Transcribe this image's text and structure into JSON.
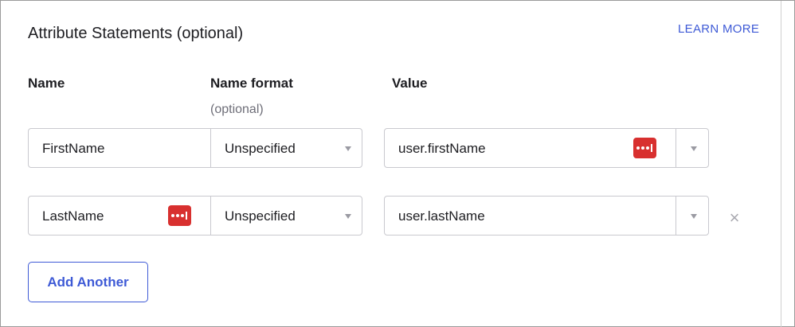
{
  "section": {
    "title": "Attribute Statements (optional)",
    "learn_more": "LEARN MORE"
  },
  "columns": {
    "name": "Name",
    "name_format": "Name format",
    "name_format_hint": "(optional)",
    "value": "Value"
  },
  "rows": [
    {
      "name": "FirstName",
      "name_format": "Unspecified",
      "value": "user.firstName",
      "password_icon_in": "value",
      "removable": false
    },
    {
      "name": "LastName",
      "name_format": "Unspecified",
      "value": "user.lastName",
      "password_icon_in": "name",
      "removable": true
    }
  ],
  "actions": {
    "add_another": "Add Another",
    "remove_symbol": "×"
  },
  "colors": {
    "accent": "#3e5ad6",
    "password_icon": "#d8302f",
    "border": "#c9c9cf"
  }
}
